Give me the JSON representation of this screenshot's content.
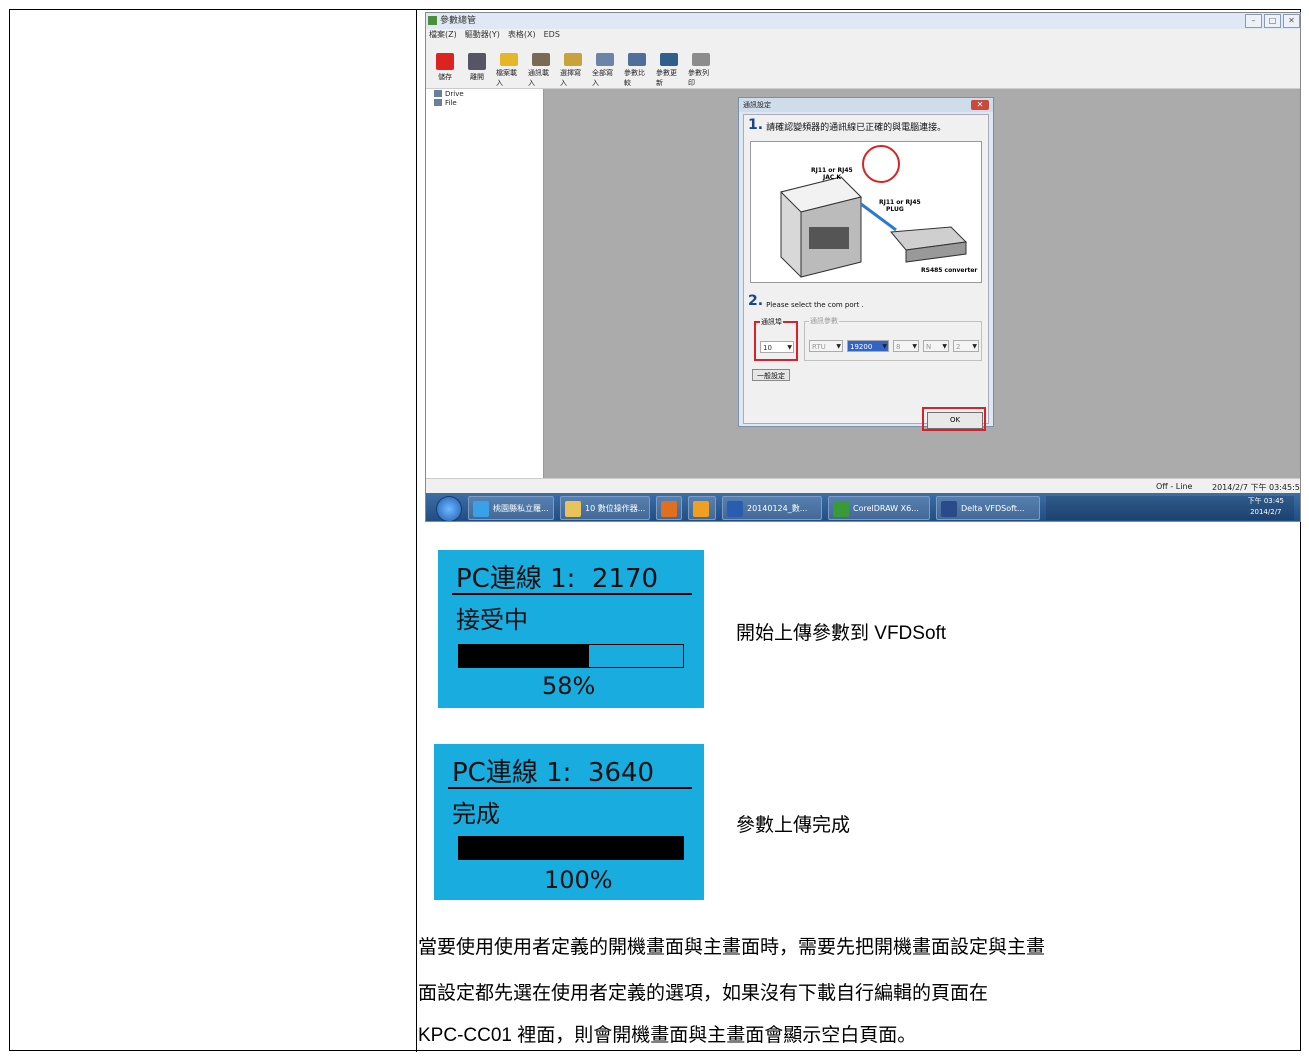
{
  "screenshot": {
    "window_title": "參數總管",
    "menu": [
      "檔案(Z)",
      "驅動器(Y)",
      "表格(X)",
      "EDS"
    ],
    "toolbar": [
      "儲存",
      "離開",
      "檔案載入",
      "通訊載入",
      "選擇寫入",
      "全部寫入",
      "參數比較",
      "參數更新",
      "參數列印"
    ],
    "tree": [
      "Drive",
      "File"
    ],
    "dialog": {
      "title": "通訊設定",
      "step1_num": "1.",
      "step1_text": "請確認變頻器的通訊線已正確的與電腦連接。",
      "img_labels": {
        "jack": "RJ11 or RJ45\nJAC K",
        "plug": "RJ11 or RJ45\nPLUG",
        "conv": "RS485 converter"
      },
      "step2_num": "2.",
      "step2_text": "Please select the com port .",
      "group_port": "通訊埠",
      "group_params": "通訊參數",
      "port_value": "10",
      "params": [
        "RTU",
        "19200",
        "8",
        "N",
        "2"
      ],
      "general_button": "一般設定",
      "ok_button": "OK"
    },
    "status": {
      "mode": "Off - Line",
      "datetime": "2014/2/7 下午 03:45:5"
    },
    "taskbar": [
      "桃園縣私立羅...",
      "10 數位操作器...",
      "",
      "",
      "20140124_數...",
      "CorelDRAW X6...",
      "Delta VFDSoft..."
    ],
    "tray_clock": "下午 03:45\n2014/2/7"
  },
  "lcd1": {
    "line1": "PC連線 1:  2170",
    "line2": "接受中",
    "progress": 0.58,
    "percent": "58%"
  },
  "caption1": "開始上傳參數到 VFDSoft",
  "lcd2": {
    "line1": "PC連線 1:  3640",
    "line2": "完成",
    "progress": 1.0,
    "percent": "100%"
  },
  "caption2": "參數上傳完成",
  "paragraph": [
    "當要使用使用者定義的開機畫面與主畫面時，需要先把開機畫面設定與主畫",
    "面設定都先選在使用者定義的選項，如果沒有下載自行編輯的頁面在",
    "KPC-CC01 裡面，則會開機畫面與主畫面會顯示空白頁面。"
  ]
}
